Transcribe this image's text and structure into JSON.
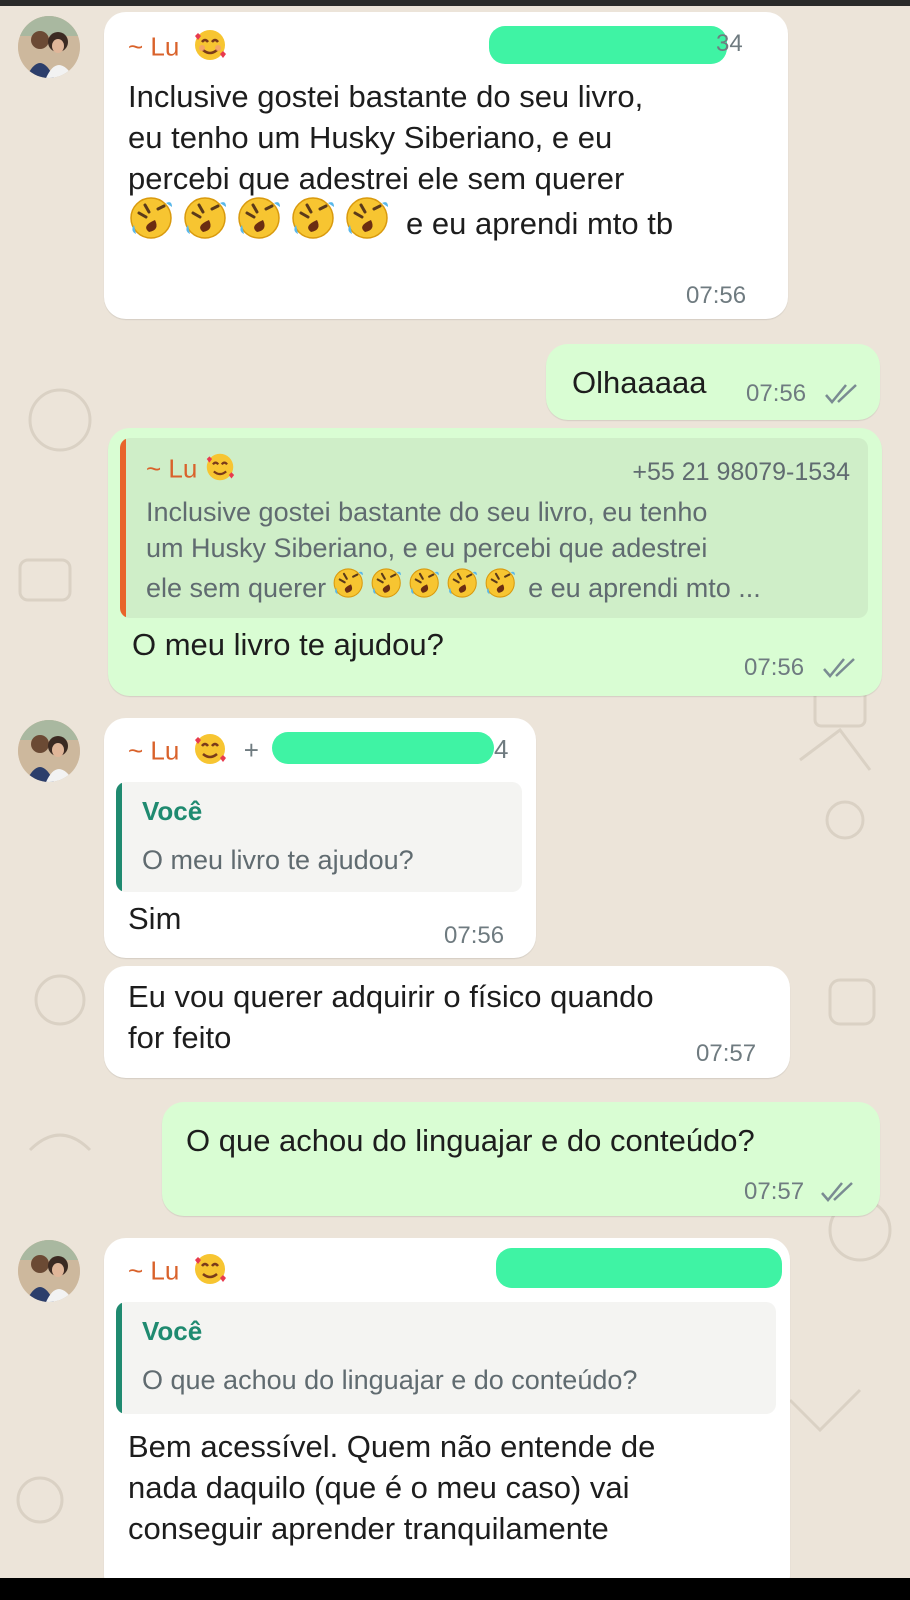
{
  "chat": {
    "messages": [
      {
        "sender": "~ Lu",
        "phone_suffix": "34",
        "text_lines": [
          "Inclusive gostei bastante do seu livro,",
          "eu tenho um Husky Siberiano, e eu",
          "percebi que adestrei ele sem querer"
        ],
        "text_tail": "e eu aprendi mto tb",
        "time": "07:56"
      },
      {
        "text": "Olhaaaaa",
        "time": "07:56"
      },
      {
        "quoted_sender": "~ Lu",
        "quoted_phone": "+55 21 98079-1534",
        "quoted_lines": [
          "Inclusive gostei bastante do seu livro, eu tenho",
          "um Husky Siberiano, e eu percebi que adestrei"
        ],
        "quoted_tail_before": "ele sem querer",
        "quoted_tail_after": "e eu aprendi mto ...",
        "text": "O meu livro te ajudou?",
        "time": "07:56"
      },
      {
        "sender": "~ Lu",
        "phone_prefix": "+",
        "phone_suffix": "4",
        "quoted_sender": "Você",
        "quoted_text": "O meu livro te ajudou?",
        "text": "Sim",
        "time": "07:56"
      },
      {
        "text_lines": [
          "Eu vou querer adquirir o físico quando",
          "for feito"
        ],
        "time": "07:57"
      },
      {
        "text": "O que achou do linguajar e do conteúdo?",
        "time": "07:57"
      },
      {
        "sender": "~ Lu",
        "quoted_sender": "Você",
        "quoted_text": "O que achou do linguajar e do conteúdo?",
        "text_lines": [
          "Bem acessível. Quem não entende de",
          "nada daquilo (que é o meu caso) vai",
          "conseguir aprender tranquilamente"
        ]
      }
    ]
  },
  "colors": {
    "incoming": "#ffffff",
    "outgoing": "#d9fdd3",
    "sender_name": "#d9622b",
    "quote_you": "#1f8a70",
    "redaction": "#3ff3a4",
    "background": "#ece4d9"
  },
  "icons": {
    "avatar": "profile-photo",
    "heart_face": "smiling-face-with-hearts-emoji",
    "laugh": "rolling-on-floor-laughing-emoji",
    "read_receipt": "double-check-icon"
  }
}
